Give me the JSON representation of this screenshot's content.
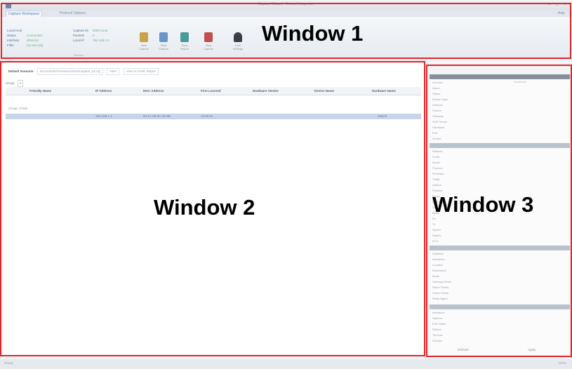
{
  "titlebar": {
    "title": "Capture Wizard - Network Inspector",
    "minimize": "–",
    "maximize": "□",
    "close": "×"
  },
  "ribbon": {
    "tabs": [
      "Capture Workspace",
      "Protocol Options"
    ],
    "help": "Help",
    "info_left": [
      {
        "key": "Local Host",
        "value": ""
      },
      {
        "key": "Status",
        "value": "Connected"
      },
      {
        "key": "Interface",
        "value": "Ethernet"
      },
      {
        "key": "Filter",
        "value": "tcp and udp"
      }
    ],
    "info_right": [
      {
        "key": "Capture ID",
        "value": "0000-1234"
      },
      {
        "key": "Packets",
        "value": "0"
      },
      {
        "key": "Local IP",
        "value": "192.168.1.5"
      }
    ],
    "group_caption": "Session",
    "buttons": [
      {
        "label": "New Capture",
        "icon": "new-capture-icon",
        "color": "#c9a34a"
      },
      {
        "label": "Start Capture",
        "icon": "start-capture-icon",
        "color": "#6a95c9"
      },
      {
        "label": "Save Report",
        "icon": "save-report-icon",
        "color": "#4a9a9a"
      },
      {
        "label": "Stop Capture",
        "icon": "stop-capture-icon",
        "color": "#c0504d"
      },
      {
        "label": "User Settings",
        "icon": "user-settings-icon",
        "color": "#3a3f47"
      }
    ]
  },
  "main": {
    "address_label": "Default Scenario",
    "address_value": "Documents/Scenarios/2024/capture_01.cfg",
    "address_extra": "Filter",
    "address_extra2": "View in HTML Report",
    "toolbar_label": "Group",
    "toolbar_btn": "≡",
    "columns": [
      "Friendly Name",
      "IP Address",
      "MAC Address",
      "First Learned",
      "Hardware Vendor",
      "Device Name",
      "Hardware Name"
    ],
    "group_row": "Group: (7/16)",
    "row": [
      "",
      "192.168.1.1",
      "00:1A:2B:3C:4D:5E",
      "12:00:01",
      "",
      "",
      "Switch"
    ]
  },
  "props": {
    "sections": [
      "General",
      "Network",
      "Statistics",
      "Interfaces",
      "Advanced"
    ],
    "lines": [
      "Name",
      "Status",
      "Device Type",
      "Address",
      "Subnet",
      "Gateway",
      "DNS Server",
      "Hardware",
      "Port",
      "Vendor",
      "VLAN",
      "Model",
      "Protocol",
      "Firmware",
      "Traffic",
      "Uptime",
      "Packets",
      "Errors",
      "Last Seen",
      "Up",
      "Bytes",
      "Rx",
      "Tx",
      "Speed",
      "Duplex",
      "MTU",
      "Interfaces",
      "Location",
      "Description",
      "Mode",
      "Gateway Mode",
      "Name Server",
      "Subnet Mask",
      "Relay Agent",
      "Options",
      "Port Offset",
      "Retries",
      "Timeout",
      "Domain"
    ],
    "footer_left": "Refresh",
    "footer_right": "Apply"
  },
  "statusbar": {
    "text": "Ready",
    "right": "100%"
  },
  "annotations": {
    "window1": "Window 1",
    "window2": "Window 2",
    "window3": "Window 3",
    "box_color": "#e0252b"
  }
}
